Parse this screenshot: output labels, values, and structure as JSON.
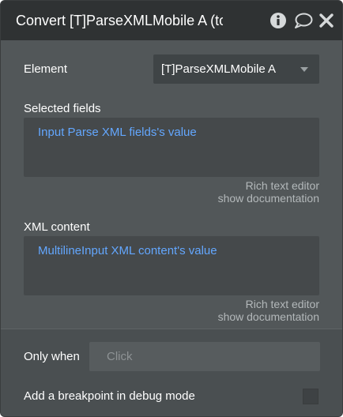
{
  "header": {
    "title": "Convert [T]ParseXMLMobile A (to",
    "icons": [
      "info-icon",
      "comment-icon",
      "close-icon"
    ]
  },
  "element": {
    "label": "Element",
    "selected": "[T]ParseXMLMobile A"
  },
  "selected_fields": {
    "label": "Selected fields",
    "value": "Input Parse XML fields's value",
    "hint_editor": "Rich text editor",
    "hint_docs": "show documentation"
  },
  "xml_content": {
    "label": "XML content",
    "value": "MultilineInput XML content's value",
    "hint_editor": "Rich text editor",
    "hint_docs": "show documentation"
  },
  "only_when": {
    "label": "Only when",
    "placeholder": "Click"
  },
  "breakpoint": {
    "label": "Add a breakpoint in debug mode",
    "checked": false
  },
  "colors": {
    "panel_bg": "#525759",
    "title_bg": "#2f3233",
    "link_text": "#63a7ff",
    "hint_text": "#b3b8ba"
  }
}
